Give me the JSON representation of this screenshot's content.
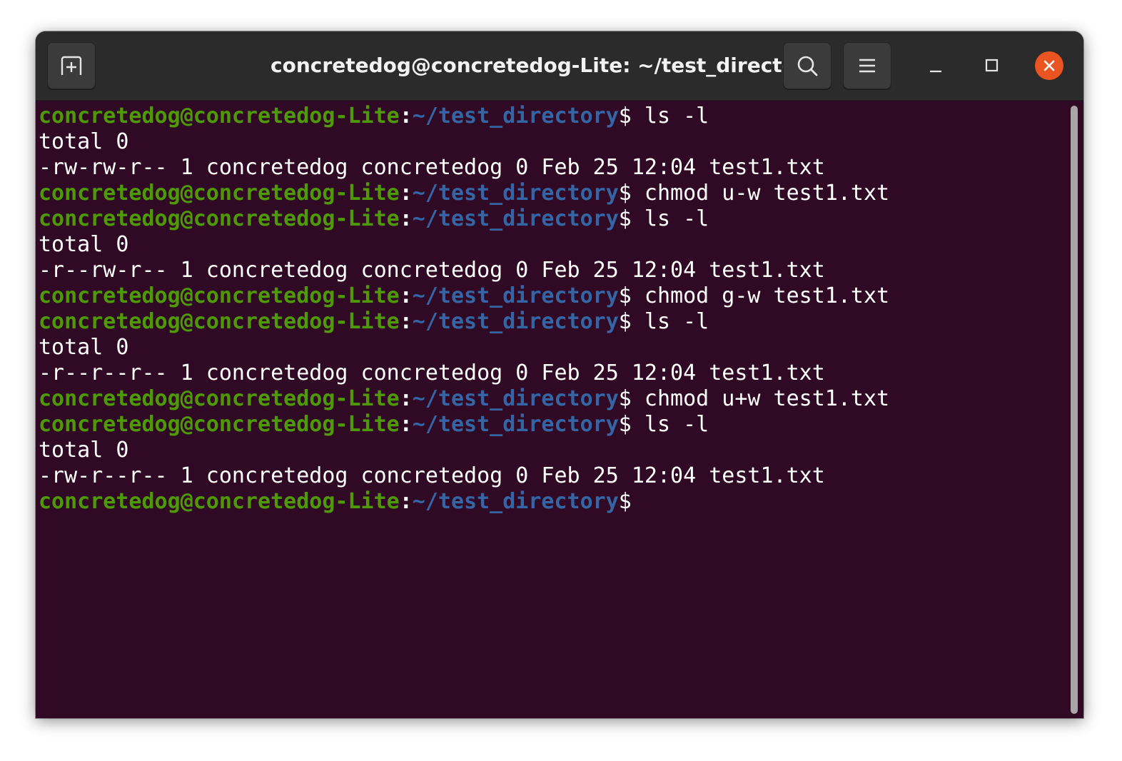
{
  "window": {
    "title": "concretedog@concretedog-Lite: ~/test_directory"
  },
  "icons": {
    "new_tab": "new-tab-icon",
    "search": "search-icon",
    "menu": "hamburger-menu-icon",
    "minimize": "minimize-icon",
    "maximize": "maximize-icon",
    "close": "close-icon"
  },
  "colors": {
    "terminal_bg": "#300a24",
    "prompt_user": "#4e9a06",
    "prompt_path": "#3465a4",
    "close_button": "#e95420",
    "titlebar": "#2b2b2b"
  },
  "terminal": {
    "prompt": {
      "user_host": "concretedog@concretedog-Lite",
      "separator": ":",
      "path": "~/test_directory",
      "symbol": "$"
    },
    "lines": [
      {
        "type": "cmd",
        "text": " ls -l"
      },
      {
        "type": "out",
        "text": "total 0"
      },
      {
        "type": "out",
        "text": "-rw-rw-r-- 1 concretedog concretedog 0 Feb 25 12:04 test1.txt"
      },
      {
        "type": "cmd",
        "text": " chmod u-w test1.txt"
      },
      {
        "type": "cmd",
        "text": " ls -l"
      },
      {
        "type": "out",
        "text": "total 0"
      },
      {
        "type": "out",
        "text": "-r--rw-r-- 1 concretedog concretedog 0 Feb 25 12:04 test1.txt"
      },
      {
        "type": "cmd",
        "text": " chmod g-w test1.txt"
      },
      {
        "type": "cmd",
        "text": " ls -l"
      },
      {
        "type": "out",
        "text": "total 0"
      },
      {
        "type": "out",
        "text": "-r--r--r-- 1 concretedog concretedog 0 Feb 25 12:04 test1.txt"
      },
      {
        "type": "cmd",
        "text": " chmod u+w test1.txt"
      },
      {
        "type": "cmd",
        "text": " ls -l"
      },
      {
        "type": "out",
        "text": "total 0"
      },
      {
        "type": "out",
        "text": "-rw-r--r-- 1 concretedog concretedog 0 Feb 25 12:04 test1.txt"
      },
      {
        "type": "cmd",
        "text": ""
      }
    ]
  }
}
